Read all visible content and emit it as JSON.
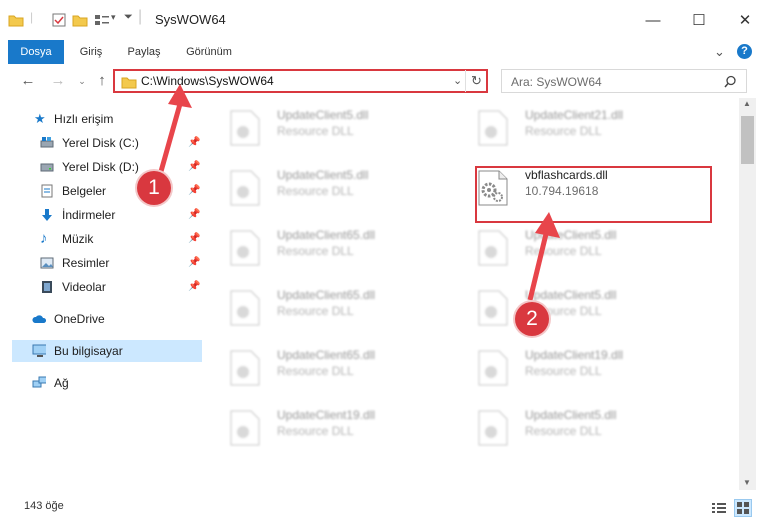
{
  "window": {
    "title": "SysWOW64",
    "minimize_glyph": "—",
    "maximize_glyph": "☐",
    "close_glyph": "✕"
  },
  "ribbon": {
    "tabs": [
      "Dosya",
      "Giriş",
      "Paylaş",
      "Görünüm"
    ],
    "help_glyph": "?",
    "collapse_glyph": "⌄"
  },
  "address": {
    "path": "C:\\Windows\\SysWOW64",
    "search_placeholder": "Ara: SysWOW64"
  },
  "nav_pane": {
    "quick_access": "Hızlı erişim",
    "items": [
      {
        "label": "Yerel Disk (C:)",
        "icon": "drive-icon"
      },
      {
        "label": "Yerel Disk (D:)",
        "icon": "drive-icon"
      },
      {
        "label": "Belgeler",
        "icon": "documents-icon"
      },
      {
        "label": "İndirmeler",
        "icon": "download-icon"
      },
      {
        "label": "Müzik",
        "icon": "music-icon"
      },
      {
        "label": "Resimler",
        "icon": "pictures-icon"
      },
      {
        "label": "Videolar",
        "icon": "videos-icon"
      }
    ],
    "onedrive": "OneDrive",
    "this_pc": "Bu bilgisayar",
    "network": "Ağ"
  },
  "files": {
    "left": [
      {
        "name": "UpdateClient5.dll",
        "desc": "Resource DLL"
      },
      {
        "name": "UpdateClient5.dll",
        "desc": "Resource DLL"
      },
      {
        "name": "UpdateClient65.dll",
        "desc": "Resource DLL"
      },
      {
        "name": "UpdateClient65.dll",
        "desc": "Resource DLL"
      },
      {
        "name": "UpdateClient65.dll",
        "desc": "Resource DLL"
      },
      {
        "name": "UpdateClient19.dll",
        "desc": "Resource DLL"
      }
    ],
    "right": [
      {
        "name": "UpdateClient21.dll",
        "desc": "Resource DLL"
      },
      {
        "name": "vbflashcards.dll",
        "desc": "10.794.19618"
      },
      {
        "name": "UpdateClient5.dll",
        "desc": "Resource DLL"
      },
      {
        "name": "UpdateClient5.dll",
        "desc": "Resource DLL"
      },
      {
        "name": "UpdateClient19.dll",
        "desc": "Resource DLL"
      },
      {
        "name": "UpdateClient5.dll",
        "desc": "Resource DLL"
      }
    ]
  },
  "status": {
    "count": "143 öğe"
  },
  "callouts": [
    "1",
    "2"
  ],
  "colors": {
    "accent": "#1979ca",
    "annotation": "#d9383f",
    "selection": "#cce8ff"
  }
}
